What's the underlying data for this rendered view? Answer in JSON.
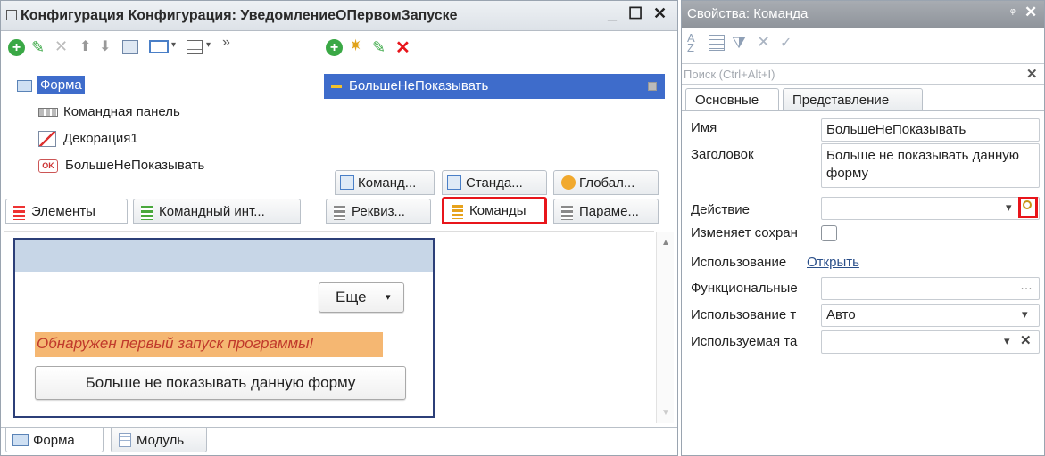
{
  "left": {
    "title": "Конфигурация Конфигурация: УведомлениеОПервомЗапуске",
    "window_controls": {
      "minimize": "_",
      "maximize": "☐",
      "close": "✕"
    },
    "tree": {
      "root": "Форма",
      "children": [
        "Командная панель",
        "Декорация1",
        "БольшеНеПоказывать"
      ],
      "ok_badge": "OK"
    },
    "commands": {
      "items": [
        "БольшеНеПоказывать"
      ],
      "bottom_tabs": [
        "Команд...",
        "Станда...",
        "Глобал..."
      ]
    },
    "tabs_left": [
      "Элементы",
      "Командный инт..."
    ],
    "tabs_right": [
      "Реквиз...",
      "Команды",
      "Параме..."
    ],
    "preview": {
      "more_button": "Еще",
      "warning_text": "Обнаружен первый запуск программы!",
      "action_button": "Больше не показывать данную форму"
    },
    "bottom_tabs": [
      "Форма",
      "Модуль"
    ]
  },
  "right": {
    "title": "Свойства: Команда",
    "search_placeholder": "Поиск (Ctrl+Alt+I)",
    "tabs": [
      "Основные",
      "Представление"
    ],
    "props": [
      {
        "label": "Имя",
        "value": "БольшеНеПоказывать"
      },
      {
        "label": "Заголовок",
        "value": "Больше не показывать данную форму"
      },
      {
        "label": "Действие",
        "value": ""
      },
      {
        "label": "Изменяет сохран",
        "value": ""
      },
      {
        "label": "Использование",
        "value": "Открыть"
      },
      {
        "label": "Функциональные",
        "value": ""
      },
      {
        "label": "Использование т",
        "value": "Авто"
      },
      {
        "label": "Используемая та",
        "value": ""
      }
    ]
  },
  "colors": {
    "accent_red": "#e8151b",
    "selection_blue": "#3e6ccb",
    "warning_bg": "#f5b772",
    "warning_text": "#c0392b"
  }
}
